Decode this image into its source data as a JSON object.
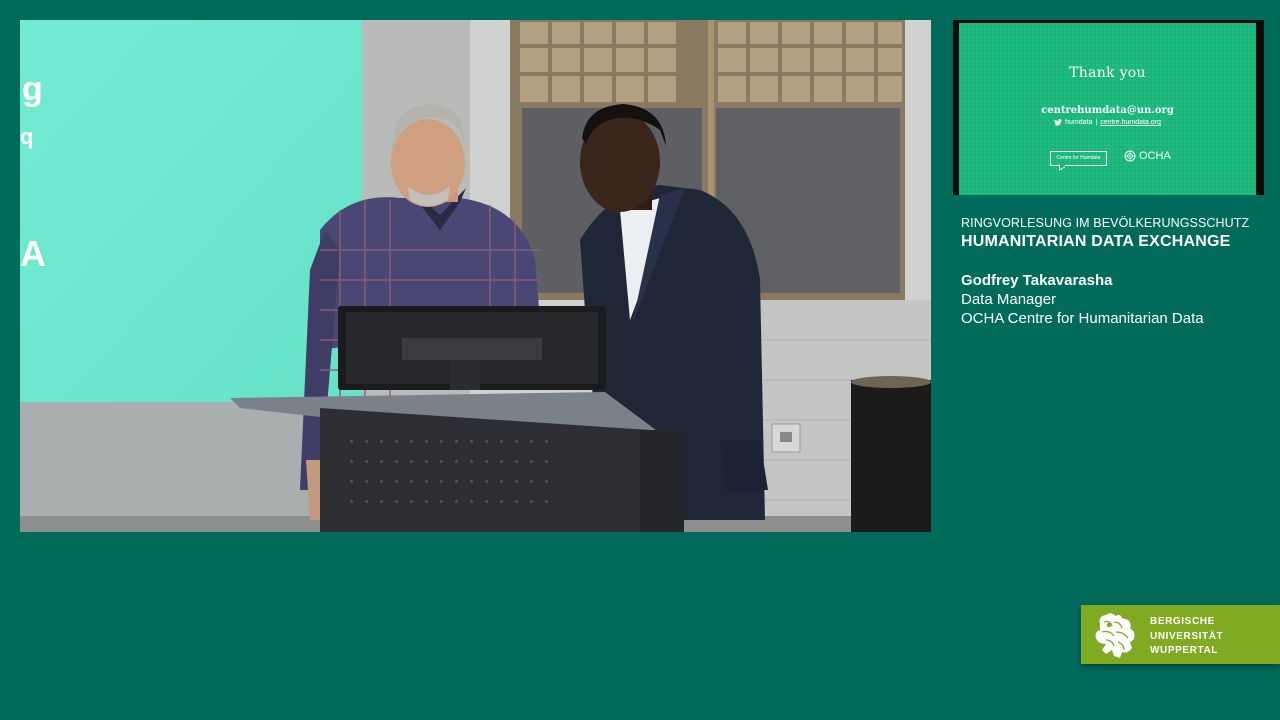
{
  "video": {
    "projector_fragments": [
      "g",
      "q",
      "A"
    ]
  },
  "slide": {
    "thanks": "Thank you",
    "email": "centrehumdata@un.org",
    "twitter_handle": "humdata",
    "separator": "|",
    "website": "centre.humdata.org",
    "logo_box": "Centre for Humdata",
    "ocha": "OCHA",
    "icons": [
      "twitter-icon",
      "un-emblem-icon"
    ]
  },
  "caption": {
    "series": "RINGVORLESUNG IM BEVÖLKERUNGSSCHUTZ",
    "title": "HUMANITARIAN DATA EXCHANGE",
    "speaker_name": "Godfrey Takavarasha",
    "speaker_role": "Data Manager",
    "speaker_org": "OCHA Centre for Humanitarian Data"
  },
  "university": {
    "line1": "BERGISCHE",
    "line2": "UNIVERSITÄT",
    "line3": "WUPPERTAL",
    "icon": "lion-crest-icon"
  },
  "colors": {
    "background": "#006a5b",
    "slide_green": "#1ab77d",
    "university_green": "#7faa22"
  }
}
